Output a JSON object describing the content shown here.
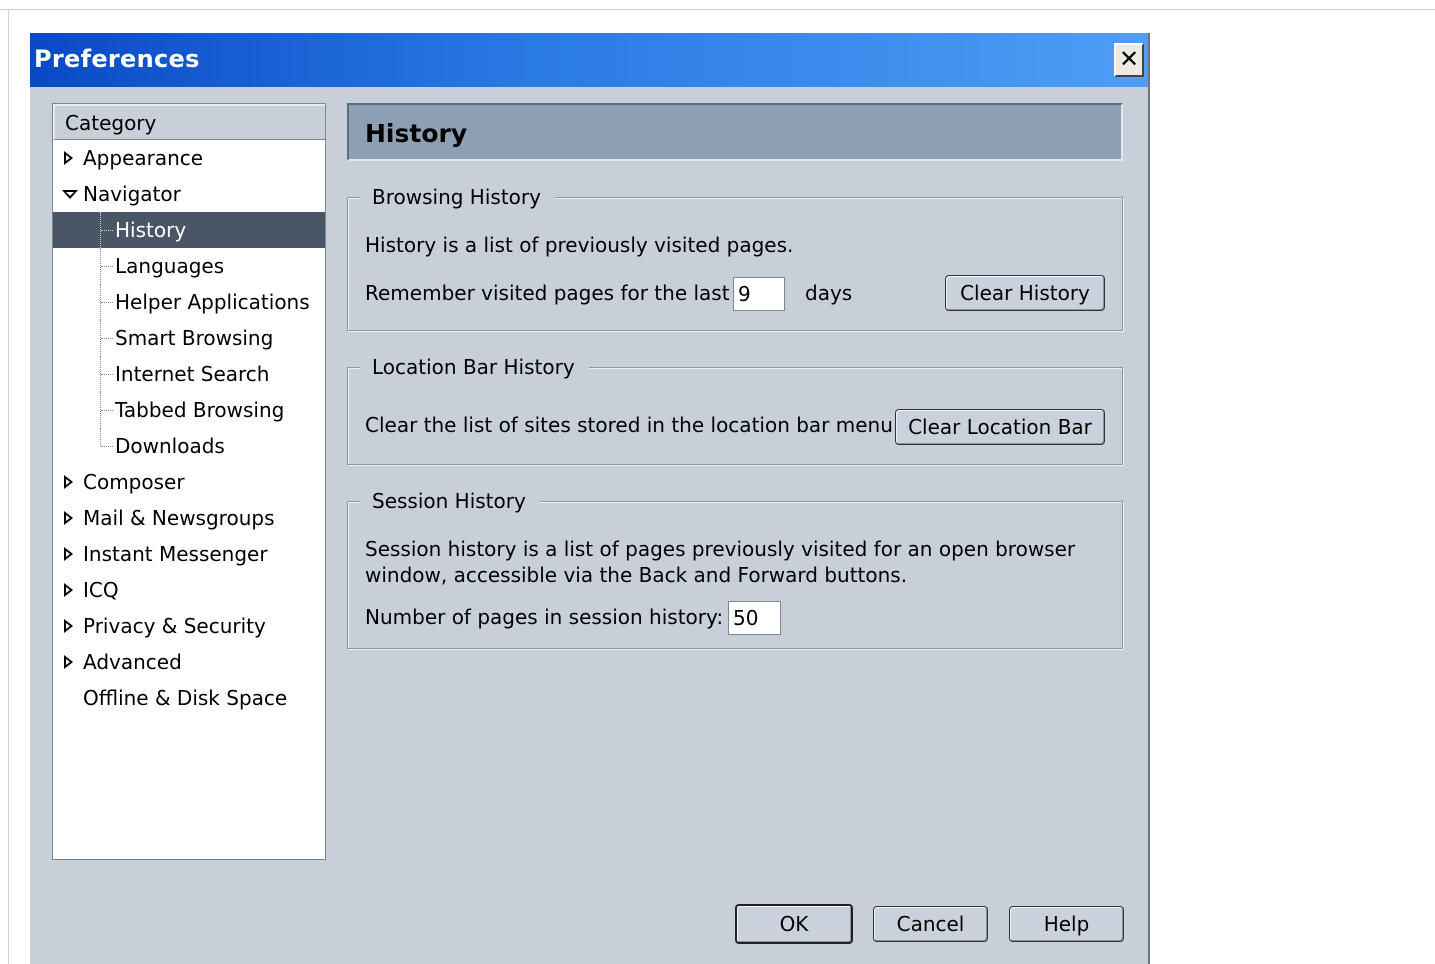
{
  "dialog": {
    "title": "Preferences",
    "close_glyph": "✕"
  },
  "tree": {
    "header": "Category",
    "items": [
      {
        "label": "Appearance",
        "expander": "closed"
      },
      {
        "label": "Navigator",
        "expander": "open"
      },
      {
        "label": "History",
        "child": true,
        "selected": true
      },
      {
        "label": "Languages",
        "child": true
      },
      {
        "label": "Helper Applications",
        "child": true
      },
      {
        "label": "Smart Browsing",
        "child": true
      },
      {
        "label": "Internet Search",
        "child": true
      },
      {
        "label": "Tabbed Browsing",
        "child": true
      },
      {
        "label": "Downloads",
        "child": true,
        "last": true
      },
      {
        "label": "Composer",
        "expander": "closed"
      },
      {
        "label": "Mail & Newsgroups",
        "expander": "closed"
      },
      {
        "label": "Instant Messenger",
        "expander": "closed"
      },
      {
        "label": "ICQ",
        "expander": "closed"
      },
      {
        "label": "Privacy & Security",
        "expander": "closed"
      },
      {
        "label": "Advanced",
        "expander": "closed"
      },
      {
        "label": "Offline & Disk Space"
      }
    ]
  },
  "panel": {
    "title": "History",
    "browsing": {
      "legend": "Browsing History",
      "description": "History is a list of previously visited pages.",
      "remember_label": "Remember visited pages for the last",
      "days_value": "9",
      "days_label": "days",
      "clear_button": "Clear History"
    },
    "location": {
      "legend": "Location Bar History",
      "description": "Clear the list of sites stored in the location bar menu.",
      "clear_button": "Clear Location Bar"
    },
    "session": {
      "legend": "Session History",
      "description_line1": "Session history is a list of pages previously visited for an open browser",
      "description_line2": "window, accessible via the Back and Forward buttons.",
      "pages_label": "Number of pages in session history:",
      "pages_value": "50"
    }
  },
  "footer": {
    "ok": "OK",
    "cancel": "Cancel",
    "help": "Help"
  }
}
